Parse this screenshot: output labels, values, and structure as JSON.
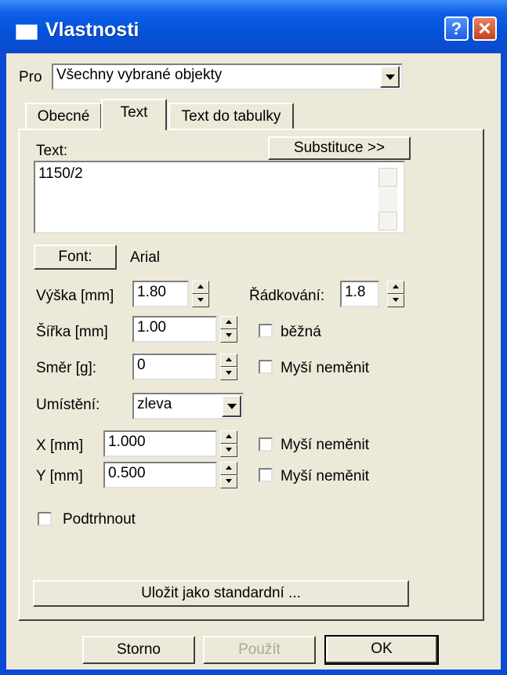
{
  "window": {
    "title": "Vlastnosti",
    "help_label": "?",
    "close_label": "✕"
  },
  "pro": {
    "label": "Pro",
    "value": "Všechny vybrané objekty"
  },
  "tabs": [
    {
      "label": "Obecné"
    },
    {
      "label": "Text"
    },
    {
      "label": "Text do tabulky"
    }
  ],
  "text_section": {
    "label": "Text:",
    "substitution_button": "Substituce >>",
    "value": "1150/2"
  },
  "font": {
    "button": "Font:",
    "value": "Arial"
  },
  "height": {
    "label": "Výška [mm]",
    "value": "1.80"
  },
  "line_spacing": {
    "label": "Řádkování:",
    "value": "1.8"
  },
  "width": {
    "label": "Šířka [mm]",
    "value": "1.00",
    "checkbox": "běžná"
  },
  "direction": {
    "label": "Směr [g]:",
    "value": "0",
    "checkbox": "Myší neměnit"
  },
  "placement": {
    "label": "Umístění:",
    "value": "zleva"
  },
  "x": {
    "label": "X [mm]",
    "value": "1.000",
    "checkbox": "Myší neměnit"
  },
  "y": {
    "label": "Y [mm]",
    "value": "0.500",
    "checkbox": "Myší neměnit"
  },
  "underline": {
    "label": "Podtrhnout"
  },
  "save_default": "Uložit jako standardní ...",
  "footer": {
    "cancel": "Storno",
    "apply": "Použít",
    "ok": "OK"
  }
}
